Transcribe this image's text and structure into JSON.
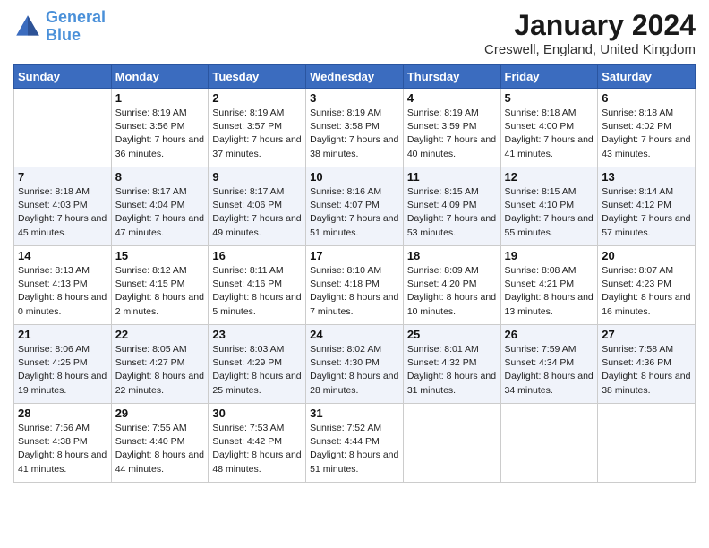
{
  "header": {
    "logo_line1": "General",
    "logo_line2": "Blue",
    "title": "January 2024",
    "location": "Creswell, England, United Kingdom"
  },
  "days_of_week": [
    "Sunday",
    "Monday",
    "Tuesday",
    "Wednesday",
    "Thursday",
    "Friday",
    "Saturday"
  ],
  "weeks": [
    [
      {
        "day": "",
        "sunrise": "",
        "sunset": "",
        "daylight": ""
      },
      {
        "day": "1",
        "sunrise": "Sunrise: 8:19 AM",
        "sunset": "Sunset: 3:56 PM",
        "daylight": "Daylight: 7 hours and 36 minutes."
      },
      {
        "day": "2",
        "sunrise": "Sunrise: 8:19 AM",
        "sunset": "Sunset: 3:57 PM",
        "daylight": "Daylight: 7 hours and 37 minutes."
      },
      {
        "day": "3",
        "sunrise": "Sunrise: 8:19 AM",
        "sunset": "Sunset: 3:58 PM",
        "daylight": "Daylight: 7 hours and 38 minutes."
      },
      {
        "day": "4",
        "sunrise": "Sunrise: 8:19 AM",
        "sunset": "Sunset: 3:59 PM",
        "daylight": "Daylight: 7 hours and 40 minutes."
      },
      {
        "day": "5",
        "sunrise": "Sunrise: 8:18 AM",
        "sunset": "Sunset: 4:00 PM",
        "daylight": "Daylight: 7 hours and 41 minutes."
      },
      {
        "day": "6",
        "sunrise": "Sunrise: 8:18 AM",
        "sunset": "Sunset: 4:02 PM",
        "daylight": "Daylight: 7 hours and 43 minutes."
      }
    ],
    [
      {
        "day": "7",
        "sunrise": "Sunrise: 8:18 AM",
        "sunset": "Sunset: 4:03 PM",
        "daylight": "Daylight: 7 hours and 45 minutes."
      },
      {
        "day": "8",
        "sunrise": "Sunrise: 8:17 AM",
        "sunset": "Sunset: 4:04 PM",
        "daylight": "Daylight: 7 hours and 47 minutes."
      },
      {
        "day": "9",
        "sunrise": "Sunrise: 8:17 AM",
        "sunset": "Sunset: 4:06 PM",
        "daylight": "Daylight: 7 hours and 49 minutes."
      },
      {
        "day": "10",
        "sunrise": "Sunrise: 8:16 AM",
        "sunset": "Sunset: 4:07 PM",
        "daylight": "Daylight: 7 hours and 51 minutes."
      },
      {
        "day": "11",
        "sunrise": "Sunrise: 8:15 AM",
        "sunset": "Sunset: 4:09 PM",
        "daylight": "Daylight: 7 hours and 53 minutes."
      },
      {
        "day": "12",
        "sunrise": "Sunrise: 8:15 AM",
        "sunset": "Sunset: 4:10 PM",
        "daylight": "Daylight: 7 hours and 55 minutes."
      },
      {
        "day": "13",
        "sunrise": "Sunrise: 8:14 AM",
        "sunset": "Sunset: 4:12 PM",
        "daylight": "Daylight: 7 hours and 57 minutes."
      }
    ],
    [
      {
        "day": "14",
        "sunrise": "Sunrise: 8:13 AM",
        "sunset": "Sunset: 4:13 PM",
        "daylight": "Daylight: 8 hours and 0 minutes."
      },
      {
        "day": "15",
        "sunrise": "Sunrise: 8:12 AM",
        "sunset": "Sunset: 4:15 PM",
        "daylight": "Daylight: 8 hours and 2 minutes."
      },
      {
        "day": "16",
        "sunrise": "Sunrise: 8:11 AM",
        "sunset": "Sunset: 4:16 PM",
        "daylight": "Daylight: 8 hours and 5 minutes."
      },
      {
        "day": "17",
        "sunrise": "Sunrise: 8:10 AM",
        "sunset": "Sunset: 4:18 PM",
        "daylight": "Daylight: 8 hours and 7 minutes."
      },
      {
        "day": "18",
        "sunrise": "Sunrise: 8:09 AM",
        "sunset": "Sunset: 4:20 PM",
        "daylight": "Daylight: 8 hours and 10 minutes."
      },
      {
        "day": "19",
        "sunrise": "Sunrise: 8:08 AM",
        "sunset": "Sunset: 4:21 PM",
        "daylight": "Daylight: 8 hours and 13 minutes."
      },
      {
        "day": "20",
        "sunrise": "Sunrise: 8:07 AM",
        "sunset": "Sunset: 4:23 PM",
        "daylight": "Daylight: 8 hours and 16 minutes."
      }
    ],
    [
      {
        "day": "21",
        "sunrise": "Sunrise: 8:06 AM",
        "sunset": "Sunset: 4:25 PM",
        "daylight": "Daylight: 8 hours and 19 minutes."
      },
      {
        "day": "22",
        "sunrise": "Sunrise: 8:05 AM",
        "sunset": "Sunset: 4:27 PM",
        "daylight": "Daylight: 8 hours and 22 minutes."
      },
      {
        "day": "23",
        "sunrise": "Sunrise: 8:03 AM",
        "sunset": "Sunset: 4:29 PM",
        "daylight": "Daylight: 8 hours and 25 minutes."
      },
      {
        "day": "24",
        "sunrise": "Sunrise: 8:02 AM",
        "sunset": "Sunset: 4:30 PM",
        "daylight": "Daylight: 8 hours and 28 minutes."
      },
      {
        "day": "25",
        "sunrise": "Sunrise: 8:01 AM",
        "sunset": "Sunset: 4:32 PM",
        "daylight": "Daylight: 8 hours and 31 minutes."
      },
      {
        "day": "26",
        "sunrise": "Sunrise: 7:59 AM",
        "sunset": "Sunset: 4:34 PM",
        "daylight": "Daylight: 8 hours and 34 minutes."
      },
      {
        "day": "27",
        "sunrise": "Sunrise: 7:58 AM",
        "sunset": "Sunset: 4:36 PM",
        "daylight": "Daylight: 8 hours and 38 minutes."
      }
    ],
    [
      {
        "day": "28",
        "sunrise": "Sunrise: 7:56 AM",
        "sunset": "Sunset: 4:38 PM",
        "daylight": "Daylight: 8 hours and 41 minutes."
      },
      {
        "day": "29",
        "sunrise": "Sunrise: 7:55 AM",
        "sunset": "Sunset: 4:40 PM",
        "daylight": "Daylight: 8 hours and 44 minutes."
      },
      {
        "day": "30",
        "sunrise": "Sunrise: 7:53 AM",
        "sunset": "Sunset: 4:42 PM",
        "daylight": "Daylight: 8 hours and 48 minutes."
      },
      {
        "day": "31",
        "sunrise": "Sunrise: 7:52 AM",
        "sunset": "Sunset: 4:44 PM",
        "daylight": "Daylight: 8 hours and 51 minutes."
      },
      {
        "day": "",
        "sunrise": "",
        "sunset": "",
        "daylight": ""
      },
      {
        "day": "",
        "sunrise": "",
        "sunset": "",
        "daylight": ""
      },
      {
        "day": "",
        "sunrise": "",
        "sunset": "",
        "daylight": ""
      }
    ]
  ]
}
